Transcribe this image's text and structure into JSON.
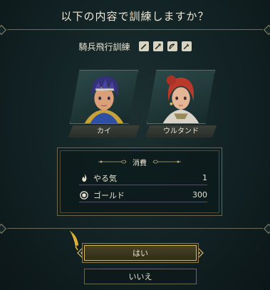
{
  "dialog": {
    "question": "以下の内容で訓練しますか？",
    "training_name": "騎兵飛行訓練",
    "weapon_badges": [
      "sword-icon",
      "lance-icon",
      "bow-icon",
      "axe-icon"
    ]
  },
  "units": [
    {
      "name": "カイ"
    },
    {
      "name": "ウルタンド"
    }
  ],
  "cost": {
    "title": "消費",
    "rows": [
      {
        "icon": "flame-icon",
        "label": "やる気",
        "value": "1"
      },
      {
        "icon": "gold-coin-icon",
        "label": "ゴールド",
        "value": "300"
      }
    ]
  },
  "buttons": {
    "yes": "はい",
    "no": "いいえ"
  },
  "colors": {
    "background": "#122224",
    "gold_accent": "#d6b962",
    "text": "#ece6d4"
  }
}
